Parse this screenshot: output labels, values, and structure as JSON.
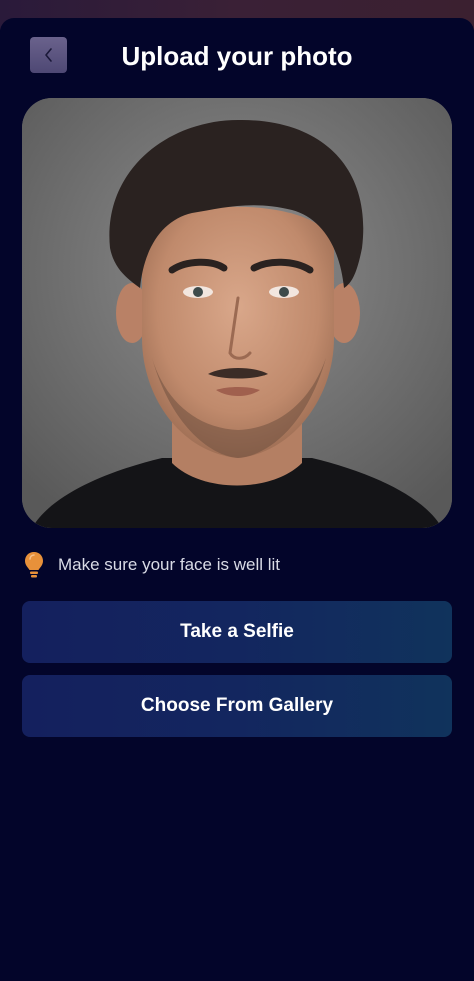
{
  "header": {
    "title": "Upload your photo",
    "back_icon": "chevron-left-icon"
  },
  "photo": {
    "description_icon": "portrait-photo"
  },
  "tip": {
    "icon": "lightbulb-icon",
    "icon_color": "#e8913a",
    "text": "Make sure your face is well lit"
  },
  "actions": {
    "take_selfie_label": "Take a Selfie",
    "choose_gallery_label": "Choose From Gallery"
  },
  "colors": {
    "background": "#03052a",
    "button": "#14205e",
    "accent": "#e8913a"
  }
}
